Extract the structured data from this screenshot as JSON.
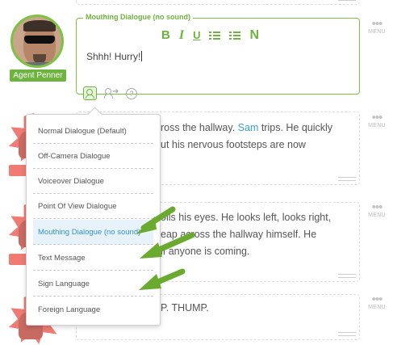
{
  "character": {
    "name": "Agent Penner"
  },
  "dialogue": {
    "title": "Mouthing Dialogue (no sound)",
    "text": "Shhh! Hurry!",
    "toolbar": {
      "bold": "B",
      "italic": "I",
      "underline": "U",
      "normal": "N"
    },
    "help": "?"
  },
  "menu_label": "MENU",
  "blocks": [
    {
      "line1_pre": "ross the hallway. ",
      "line1_name": "Sam",
      "line1_post": " trips. He quickly",
      "line2": "ut his nervous footsteps are now"
    },
    {
      "line1": "olls his eyes. He looks left, looks right,",
      "line2": "eap across the hallway himself. He",
      "line3": "if anyone is coming."
    },
    {
      "line1": "P. THUMP."
    }
  ],
  "dropdown": {
    "items": [
      "Normal Dialogue (Default)",
      "Off-Camera Dialogue",
      "Voiceover Dialogue",
      "Point Of View Dialogue",
      "Mouthing Dialogue (no sound)",
      "Text Message",
      "Sign Language",
      "Foreign Language"
    ],
    "selected_index": 4
  },
  "colors": {
    "accent_green": "#6db33f",
    "link_blue": "#3aa0d8",
    "selected_bg": "#e8f2fb",
    "burst_red": "#ef7b73",
    "arrow_green": "#6aaa2e"
  }
}
